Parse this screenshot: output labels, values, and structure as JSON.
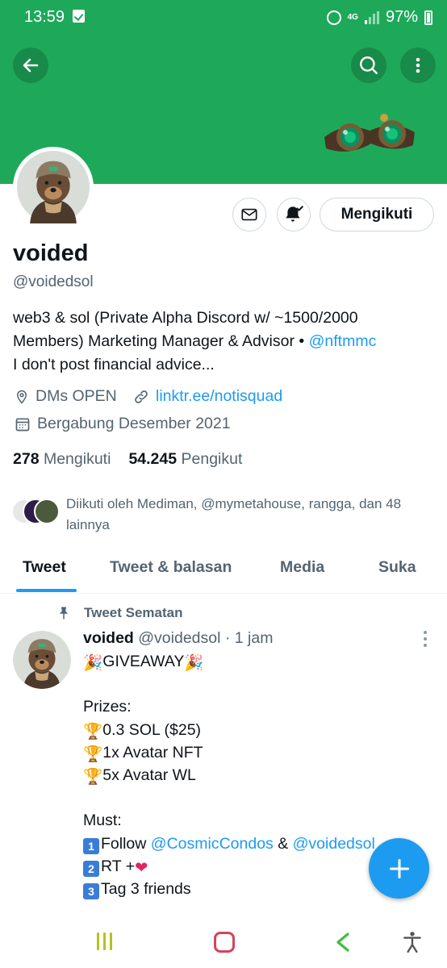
{
  "status_bar": {
    "time": "13:59",
    "network": "4G",
    "battery": "97%"
  },
  "colors": {
    "banner": "#1ea95a",
    "link": "#1d9bf0",
    "text": "#0f1419",
    "muted": "#536471"
  },
  "header": {
    "icons": [
      "arrow-left-icon",
      "search-icon",
      "more-vertical-icon"
    ]
  },
  "profile": {
    "name": "voided",
    "handle": "@voidedsol",
    "follow_label": "Mengikuti",
    "bio_line1": "web3 & sol (Private Alpha Discord w/ ~1500/2000",
    "bio_line2_prefix": "Members)  Marketing Manager & Advisor • ",
    "bio_mention": "@nftmmc",
    "bio_line3": "I don't post financial advice...",
    "location": "DMs OPEN",
    "website": "linktr.ee/notisquad",
    "joined": "Bergabung Desember 2021",
    "following_count": "278",
    "following_label": "Mengikuti",
    "followers_count": "54.245",
    "followers_label": "Pengikut",
    "followed_by": "Diikuti oleh Mediman, @mymetahouse, rangga, dan 48 lainnya"
  },
  "tabs": [
    {
      "label": "Tweet",
      "active": true
    },
    {
      "label": "Tweet & balasan",
      "active": false
    },
    {
      "label": "Media",
      "active": false
    },
    {
      "label": "Suka",
      "active": false
    }
  ],
  "pinned_tweet": {
    "pinned_label": "Tweet Sematan",
    "author_name": "voided",
    "author_handle": "@voidedsol",
    "separator": "·",
    "time": "1 jam",
    "line1": "GIVEAWAY",
    "prizes_label": "Prizes:",
    "prize1": "0.3 SOL ($25)",
    "prize2": "1x Avatar NFT",
    "prize3": "5x Avatar WL",
    "must_label": "Must:",
    "must1_prefix": "Follow ",
    "must1_mention1": "@CosmicCondos",
    "must1_amp": " & ",
    "must1_mention2": "@voidedsol",
    "must2": "RT +",
    "must3": "Tag 3 friends"
  },
  "fab": {
    "icon": "plus-icon"
  }
}
